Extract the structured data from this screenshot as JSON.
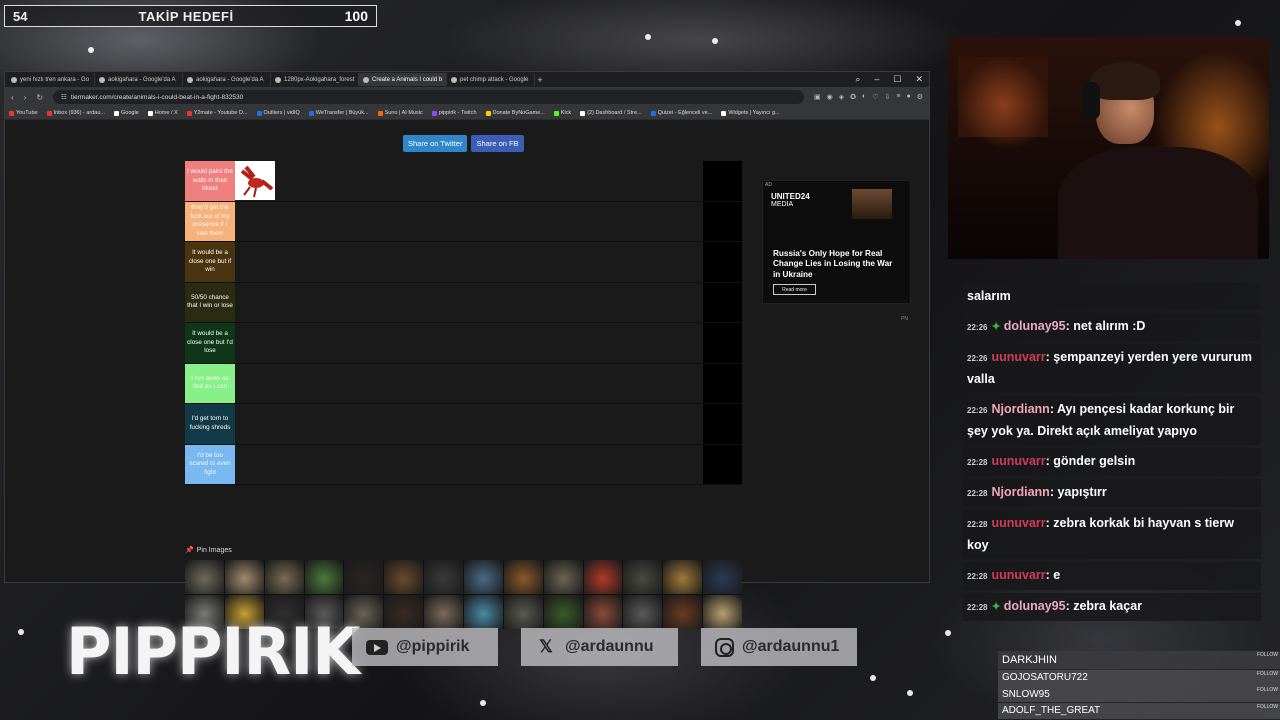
{
  "follow_goal": {
    "current": "54",
    "title": "TAKİP HEDEFİ",
    "target": "100"
  },
  "browser": {
    "tabs": [
      {
        "label": "yeni hızlı tren ankara - Go"
      },
      {
        "label": "aokigahara - Google'da A"
      },
      {
        "label": "aokigahara - Google'da A"
      },
      {
        "label": "1280px-Aokigahara_forest"
      },
      {
        "label": "Create a Animals I could b",
        "active": true
      },
      {
        "label": "pet chimp attack - Google"
      }
    ],
    "url": "tiermaker.com/create/animals-i-could-beat-in-a-fight-832530",
    "bookmarks": [
      "YouTube",
      "Inbox (936) - ardau...",
      "Google",
      "Home / X",
      "Y2mate - Youtube D...",
      "Outliers | vidIQ",
      "WeTransfer | Büyük...",
      "Suno | AI Music",
      "pippirik - Twitch",
      "Donate ByNoGame...",
      "Kick",
      "(2) Dashboard / Stre...",
      "Quizei - Eğlenceli ve...",
      "Widgets | Yayıncı g..."
    ]
  },
  "page": {
    "share_twitter": "Share on Twitter",
    "share_fb": "Share on FB",
    "tiers": [
      {
        "label": "I would paint the walls in their blood",
        "color": "#f08080"
      },
      {
        "label": "they'd get the fuck out of my presence if I saw them",
        "color": "#f6b27a"
      },
      {
        "label": "It would be a close one but if win",
        "color": "#4a3410"
      },
      {
        "label": "50/50 chance that I win or lose",
        "color": "#2b2b12"
      },
      {
        "label": "It would be a close one but I'd lose",
        "color": "#10361a"
      },
      {
        "label": "I run away as fast as I can",
        "color": "#88f088"
      },
      {
        "label": "I'd get torn to fucking shreds",
        "color": "#123a46"
      },
      {
        "label": "I'd be too scared to even fight",
        "color": "#7ab8f2"
      }
    ],
    "pin_label": "Pin Images",
    "ad": {
      "tag": "AD",
      "brand": "UNITED24",
      "brand_sub": "MEDIA",
      "headline": "Russia's Only Hope for Real Change Lies in Losing the War in Ukraine",
      "button": "Read more"
    },
    "pn": "PN"
  },
  "chat": [
    {
      "time": "",
      "user": "",
      "text": "salarım"
    },
    {
      "time": "22:26",
      "user": "dolunay95",
      "badge": true,
      "text": ": net alırım :D"
    },
    {
      "time": "22:26",
      "user": "uunuvarr",
      "text": ": şempanzeyi yerden yere vururum valla"
    },
    {
      "time": "22:26",
      "user": "Njordiann",
      "text": ": Ayı pençesi kadar korkunç bir şey yok ya. Direkt açık ameliyat yapıyo"
    },
    {
      "time": "22:28",
      "user": "uunuvarr",
      "text": ": gönder gelsin"
    },
    {
      "time": "22:28",
      "user": "Njordiann",
      "text": ": yapıştırr"
    },
    {
      "time": "22:28",
      "user": "uunuvarr",
      "text": ": zebra korkak bi hayvan s tierw koy"
    },
    {
      "time": "22:28",
      "user": "uunuvarr",
      "text": ": e"
    },
    {
      "time": "22:28",
      "user": "dolunay95",
      "badge": true,
      "text": ": zebra kaçar"
    }
  ],
  "overlay": {
    "logo": "PIPPIRIK",
    "youtube": "@pippirik",
    "x": "@ardaunnu",
    "instagram": "@ardaunnu1",
    "followers": [
      "DARKJHIN",
      "GOJOSATORU722",
      "SNLOW95",
      "ADOLF_THE_GREAT"
    ],
    "follow_tag": "FOLLOW"
  }
}
